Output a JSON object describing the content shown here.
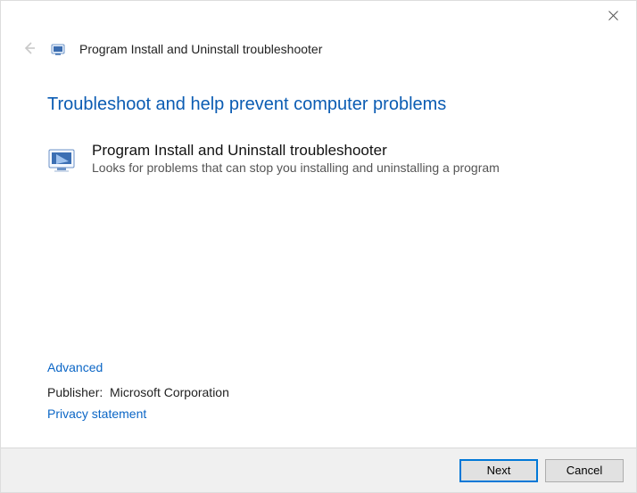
{
  "window": {
    "title": "Program Install and Uninstall troubleshooter"
  },
  "heading": "Troubleshoot and help prevent computer problems",
  "item": {
    "title": "Program Install and Uninstall troubleshooter",
    "description": "Looks for problems that can stop you installing and uninstalling a program"
  },
  "links": {
    "advanced": "Advanced",
    "privacy": "Privacy statement"
  },
  "publisher": {
    "label": "Publisher:",
    "value": "Microsoft Corporation"
  },
  "buttons": {
    "next": "Next",
    "cancel": "Cancel"
  }
}
